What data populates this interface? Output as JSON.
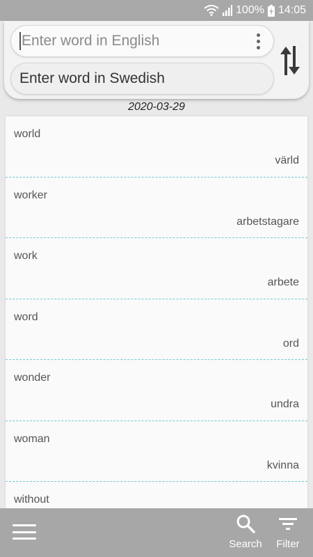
{
  "status_bar": {
    "battery_percent": "100%",
    "time": "14:05",
    "icons": [
      "wifi-icon",
      "signal-icon",
      "battery-charging-icon"
    ]
  },
  "search": {
    "english_placeholder": "Enter word in English",
    "swedish_value": "Enter word in Swedish",
    "icons": [
      "more-vert-icon",
      "swap-vertical-icon"
    ]
  },
  "list": {
    "date": "2020-03-29",
    "entries": [
      {
        "english": "world",
        "swedish": "värld"
      },
      {
        "english": "worker",
        "swedish": "arbetstagare"
      },
      {
        "english": "work",
        "swedish": "arbete"
      },
      {
        "english": "word",
        "swedish": "ord"
      },
      {
        "english": "wonder",
        "swedish": "undra"
      },
      {
        "english": "woman",
        "swedish": "kvinna"
      },
      {
        "english": "without",
        "swedish": ""
      }
    ]
  },
  "bottom_bar": {
    "search_label": "Search",
    "filter_label": "Filter",
    "icons": [
      "menu-icon",
      "search-icon",
      "filter-icon"
    ]
  },
  "colors": {
    "bar_gray": "#a7a7a7",
    "divider_teal": "#6fc9d6",
    "background": "#e9e9e9"
  }
}
